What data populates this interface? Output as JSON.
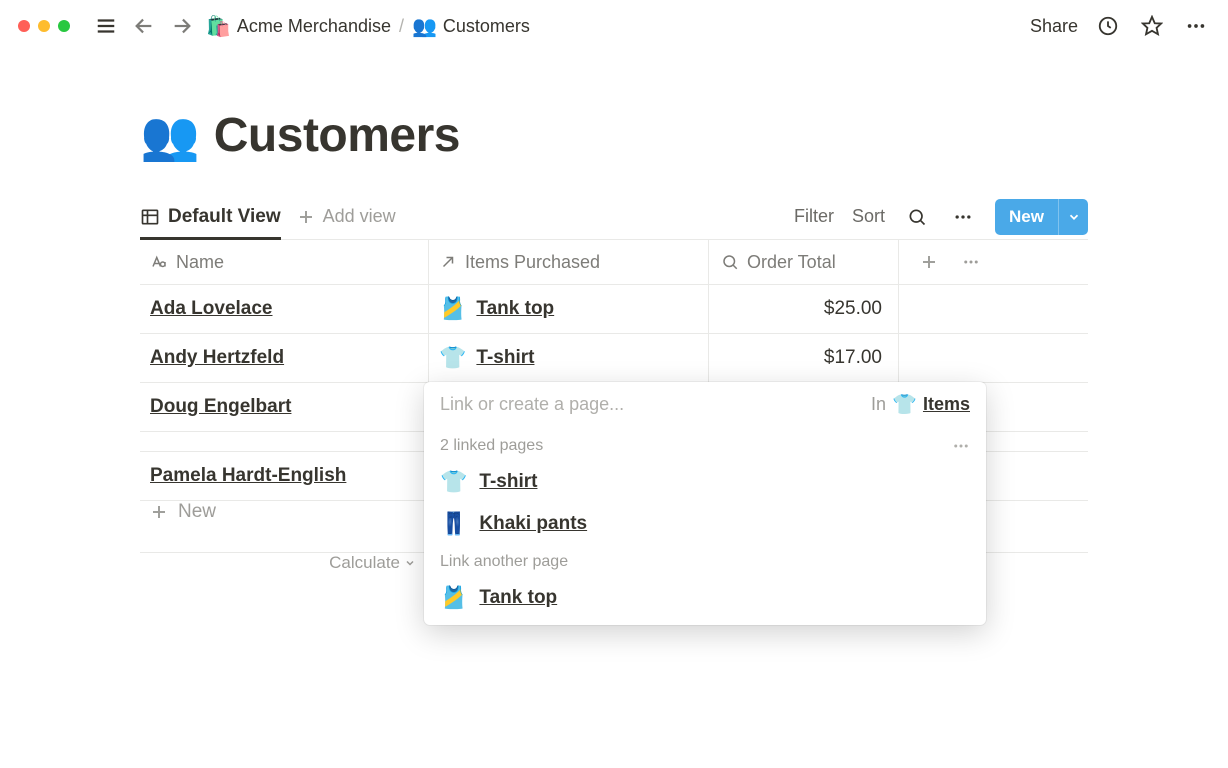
{
  "breadcrumb": {
    "parent_icon": "🛍️",
    "parent_label": "Acme Merchandise",
    "current_icon": "👥",
    "current_label": "Customers"
  },
  "topbar": {
    "share_label": "Share"
  },
  "page": {
    "icon": "👥",
    "title": "Customers"
  },
  "views": {
    "active_label": "Default View",
    "add_label": "Add view",
    "filter_label": "Filter",
    "sort_label": "Sort",
    "new_label": "New"
  },
  "columns": {
    "name": "Name",
    "items": "Items Purchased",
    "total": "Order Total"
  },
  "rows": [
    {
      "name": "Ada Lovelace",
      "item_icon": "🎽",
      "item_label": "Tank top",
      "total": "$25.00"
    },
    {
      "name": "Andy Hertzfeld",
      "item_icon": "👕",
      "item_label": "T-shirt",
      "total": "$17.00"
    },
    {
      "name": "Doug Engelbart",
      "item_icon": "",
      "item_label": "",
      "total": ""
    },
    {
      "name": "Pamela Hardt-English",
      "item_icon": "",
      "item_label": "",
      "total": ""
    }
  ],
  "new_row_label": "New",
  "footer": {
    "calculate_label": "Calculate"
  },
  "popover": {
    "placeholder": "Link or create a page...",
    "in_label": "In",
    "db_icon": "👕",
    "db_name": "Items",
    "linked_label": "2 linked pages",
    "linked": [
      {
        "icon": "👕",
        "label": "T-shirt"
      },
      {
        "icon": "👖",
        "label": "Khaki pants"
      }
    ],
    "another_label": "Link another page",
    "suggestions": [
      {
        "icon": "🎽",
        "label": "Tank top"
      }
    ]
  }
}
